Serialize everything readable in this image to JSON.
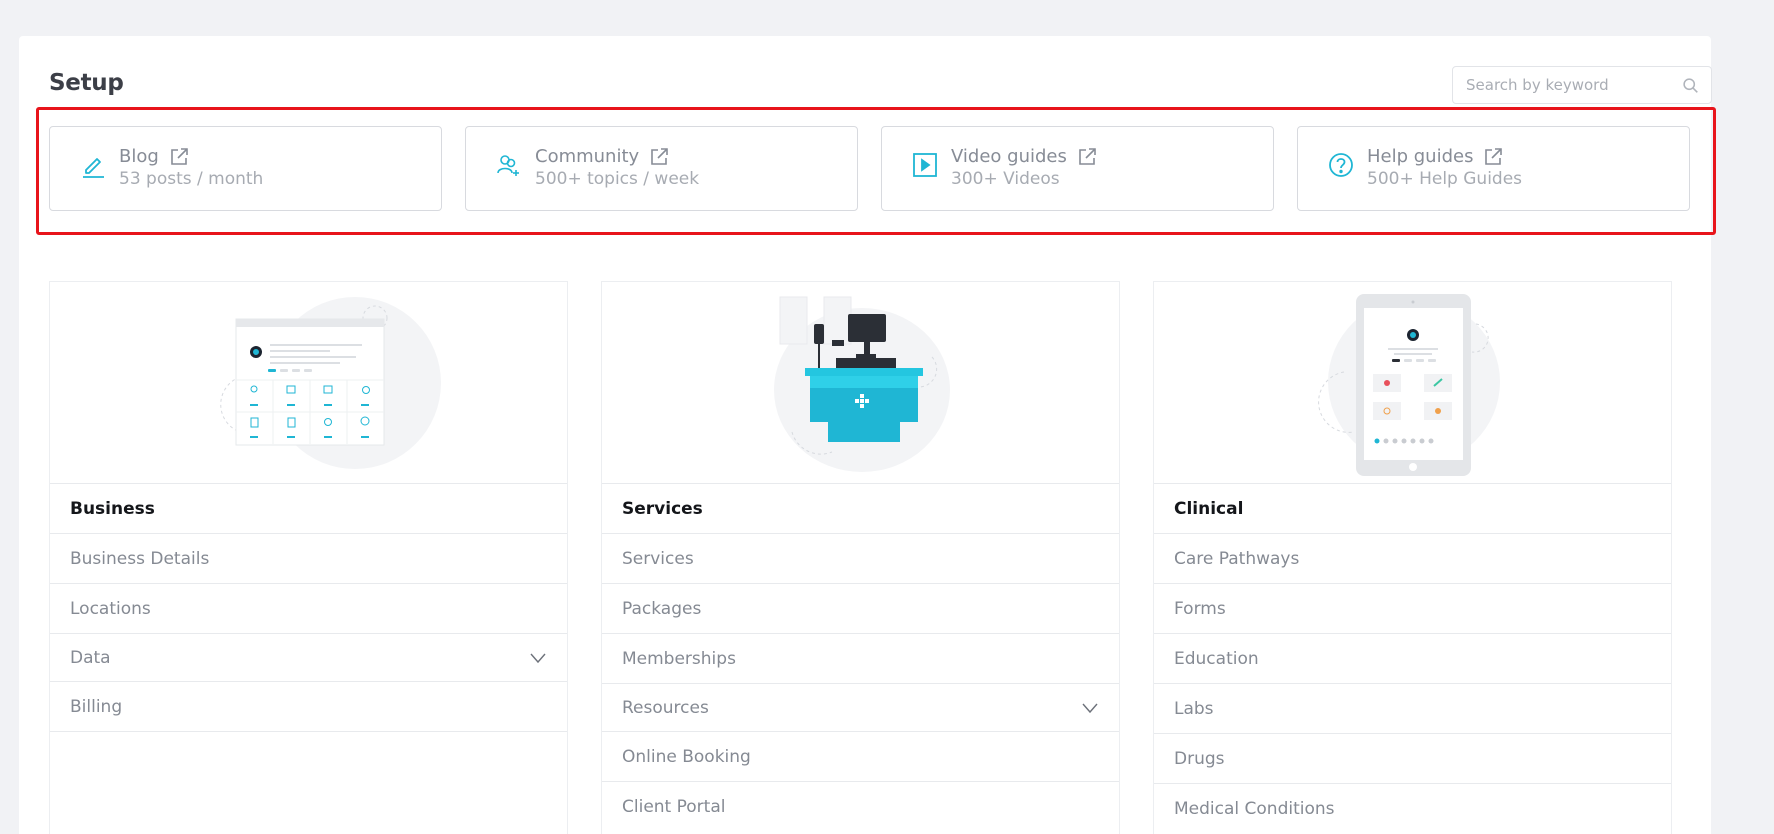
{
  "page": {
    "title": "Setup"
  },
  "search": {
    "placeholder": "Search by keyword"
  },
  "resources": [
    {
      "title": "Blog",
      "subtitle": "53 posts / month",
      "icon": "pencil-icon"
    },
    {
      "title": "Community",
      "subtitle": "500+ topics / week",
      "icon": "users-icon"
    },
    {
      "title": "Video guides",
      "subtitle": "300+ Videos",
      "icon": "play-icon"
    },
    {
      "title": "Help guides",
      "subtitle": "500+ Help Guides",
      "icon": "question-icon"
    }
  ],
  "categories": [
    {
      "title": "Business",
      "items": [
        "Business Details",
        "Locations",
        "Data",
        "Billing"
      ]
    },
    {
      "title": "Services",
      "items": [
        "Services",
        "Packages",
        "Memberships",
        "Resources",
        "Online Booking",
        "Client Portal"
      ]
    },
    {
      "title": "Clinical",
      "items": [
        "Care Pathways",
        "Forms",
        "Education",
        "Labs",
        "Drugs",
        "Medical Conditions"
      ]
    }
  ],
  "colors": {
    "accent": "#1fb6d4",
    "highlight": "#e8141b",
    "muted_text": "#878c96"
  }
}
